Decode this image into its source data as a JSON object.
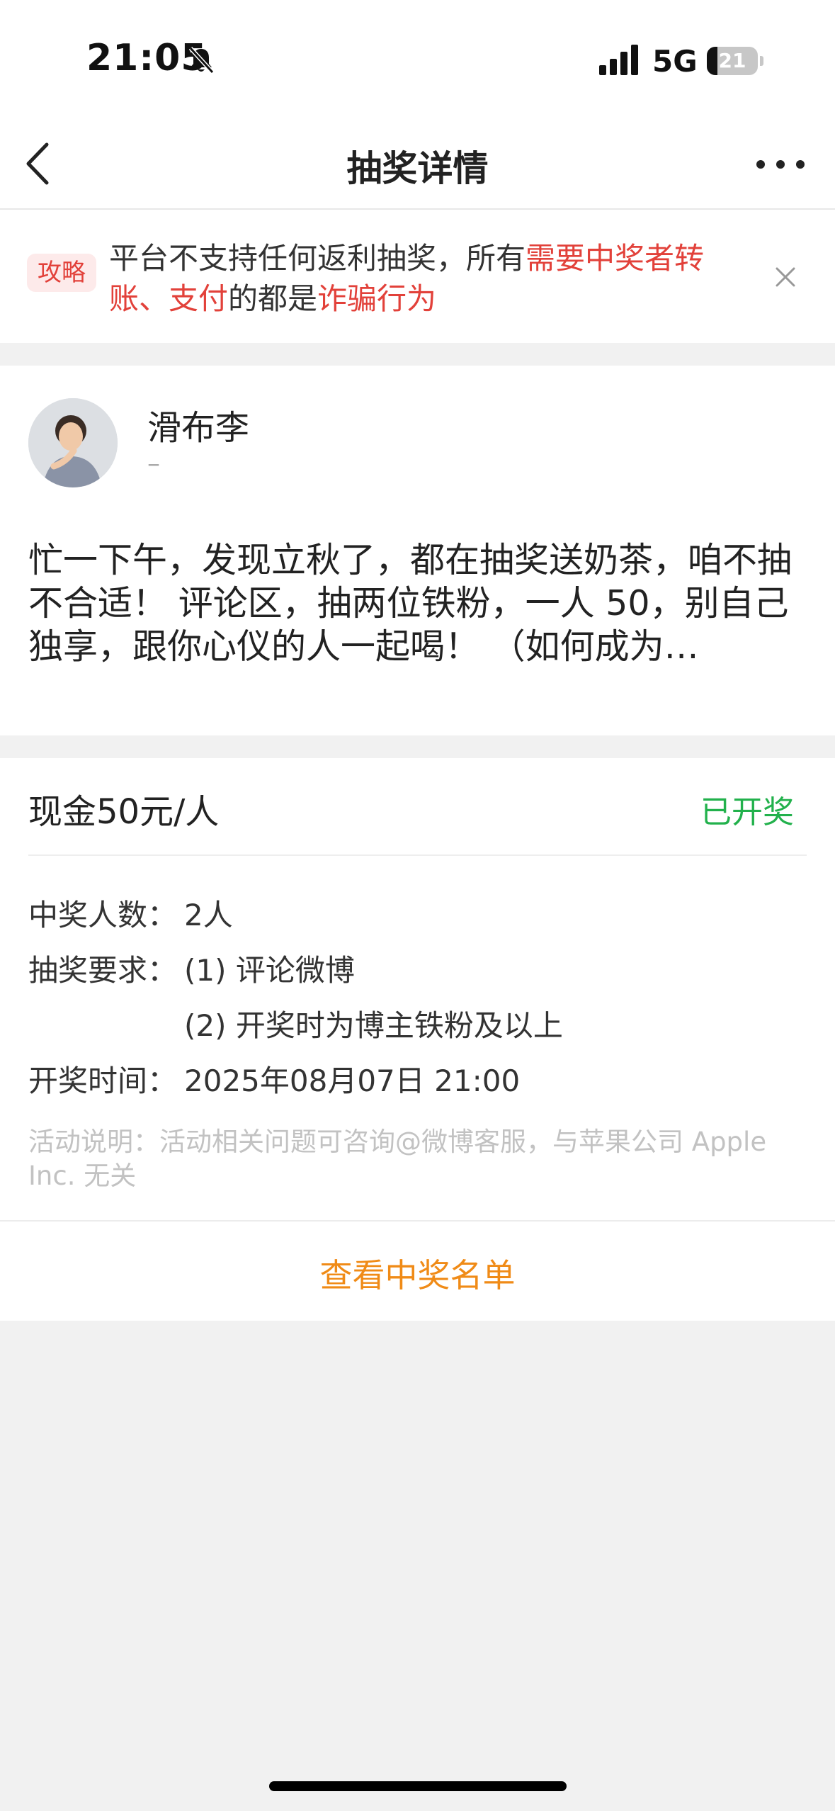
{
  "status_bar": {
    "time": "21:05",
    "network": "5G",
    "battery": "21",
    "battery_level_percent": 21
  },
  "nav": {
    "title": "抽奖详情"
  },
  "notice": {
    "tag": "攻略",
    "text_1": "平台不支持任何返利抽奖，所有",
    "highlight_1": "需要中奖者转账、支付",
    "text_2": "的都是",
    "highlight_2": "诈骗行为",
    "highlight_color": "#e2413a"
  },
  "post": {
    "author": "滑布李",
    "author_sub": "–",
    "body": "忙一下午，发现立秋了，都在抽奖送奶茶，咱不抽不合适！ 评论区，抽两位铁粉，一人 50，别自己独享，跟你心仪的人一起喝！ （如何成为…"
  },
  "prize": {
    "title": "现金50元/人",
    "status": "已开奖",
    "status_color": "#22b14c",
    "winners_label": "中奖人数：",
    "winners_value": "2人",
    "requirement_label": "抽奖要求：",
    "requirement_1": "(1) 评论微博",
    "requirement_2": "(2) 开奖时为博主铁粉及以上",
    "time_label": "开奖时间：",
    "time_value": "2025年08月07日 21:00",
    "description": "活动说明：活动相关问题可咨询@微博客服，与苹果公司 Apple Inc. 无关"
  },
  "winners_button": {
    "label": "查看中奖名单",
    "color": "#f08b17"
  },
  "icons": [
    "bell-muted-icon",
    "signal-icon",
    "battery-icon",
    "back-icon",
    "more-icon",
    "close-icon",
    "avatar"
  ]
}
